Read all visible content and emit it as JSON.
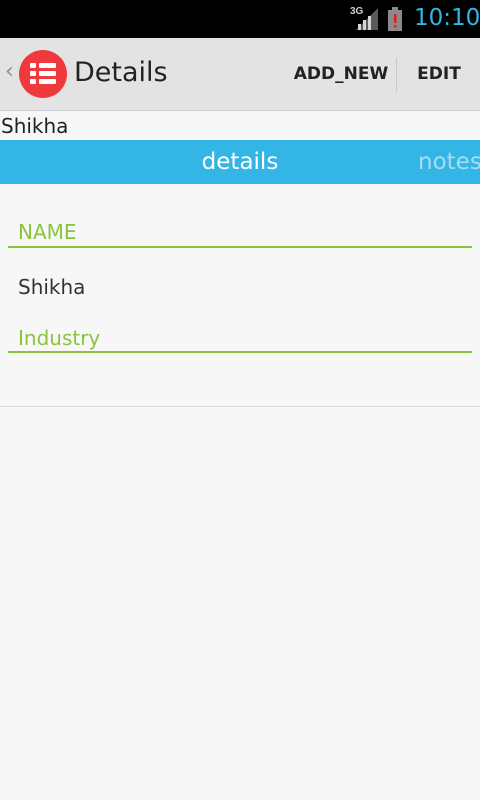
{
  "status_bar": {
    "network": "3G",
    "time": "10:10",
    "icons": [
      "signal-icon",
      "battery-alert-icon"
    ],
    "time_color": "#33b5e5"
  },
  "action_bar": {
    "title": "Details",
    "app_icon": "list-icon",
    "up_icon": "up-caret-icon",
    "icon_color": "#f0393c",
    "buttons": {
      "add_new": "ADD_NEW",
      "edit": "EDIT"
    }
  },
  "subtitle": "Shikha",
  "tabs": {
    "color": "#33b5e5",
    "items": [
      {
        "label": "details",
        "selected": true
      },
      {
        "label": "notes",
        "selected": false
      }
    ]
  },
  "fields": [
    {
      "label": "NAME",
      "value": "Shikha"
    },
    {
      "label": "Industry",
      "value": ""
    }
  ],
  "accent_color": "#8ac43f"
}
